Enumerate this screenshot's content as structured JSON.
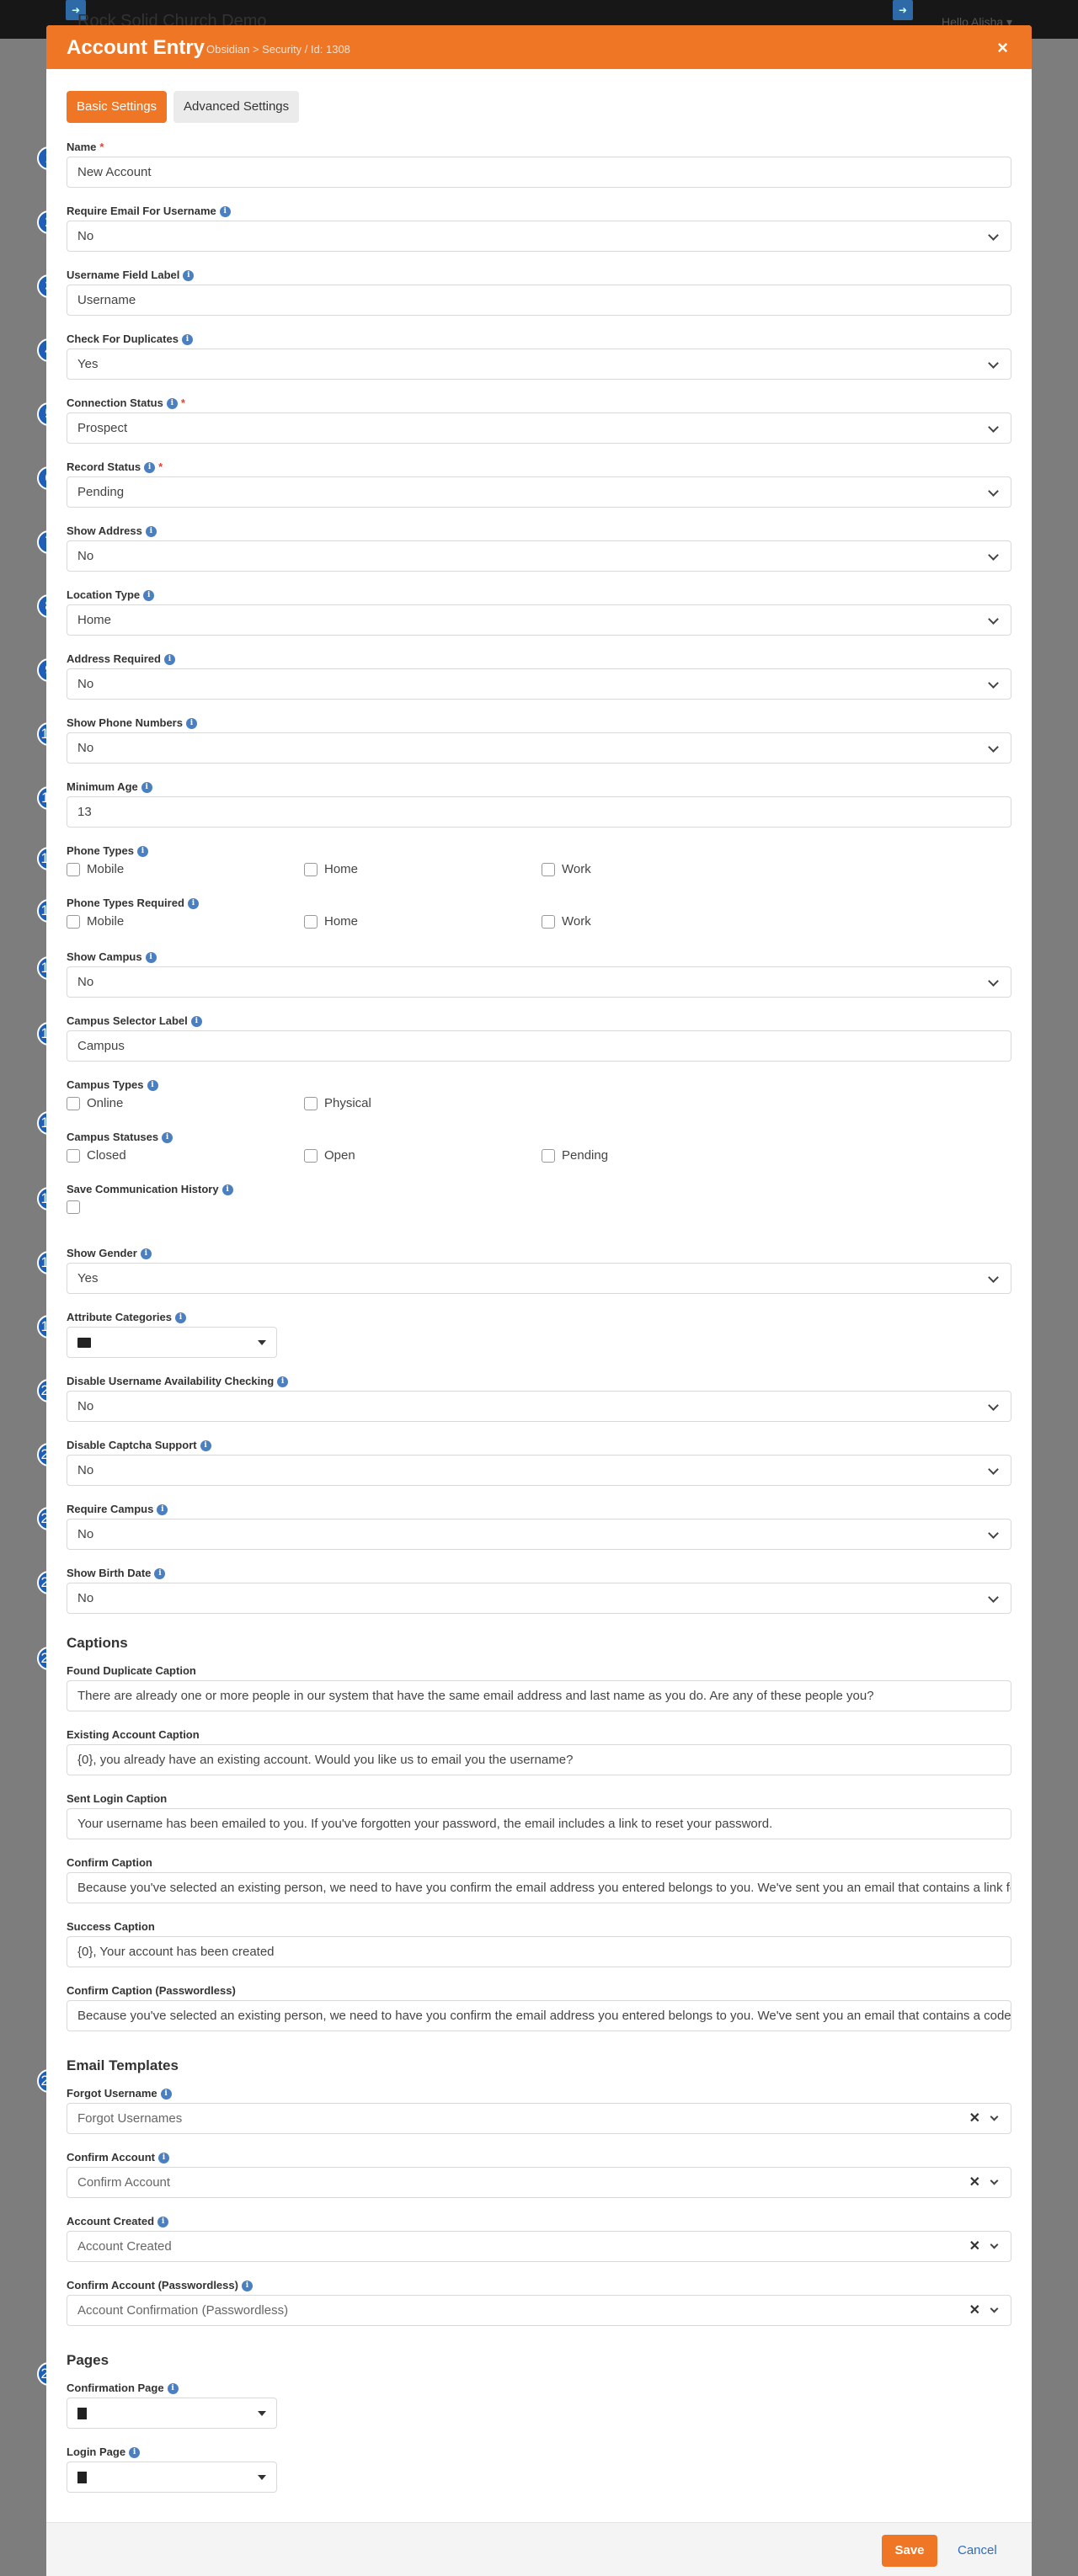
{
  "background": {
    "title": "Rock Solid Church Demo",
    "hello": "Hello Alisha ▾"
  },
  "header": {
    "title": "Account Entry",
    "subtitle": "Obsidian > Security / Id: 1308",
    "close": "×"
  },
  "tabs": [
    {
      "label": "Basic Settings"
    },
    {
      "label": "Advanced Settings"
    }
  ],
  "badges": [
    "1",
    "2",
    "3",
    "4",
    "5",
    "6",
    "7",
    "8",
    "9",
    "10",
    "11",
    "12",
    "13",
    "14",
    "15",
    "16",
    "17",
    "18",
    "19",
    "20",
    "21",
    "22",
    "23",
    "24",
    "25",
    "26"
  ],
  "fields": {
    "name": {
      "label": "Name",
      "value": "New Account"
    },
    "require_email": {
      "label": "Require Email For Username",
      "value": "No"
    },
    "username_label": {
      "label": "Username Field Label",
      "value": "Username"
    },
    "check_duplicates": {
      "label": "Check For Duplicates",
      "value": "Yes"
    },
    "connection_status": {
      "label": "Connection Status",
      "value": "Prospect"
    },
    "record_status": {
      "label": "Record Status",
      "value": "Pending"
    },
    "show_address": {
      "label": "Show Address",
      "value": "No"
    },
    "location_type": {
      "label": "Location Type",
      "value": "Home"
    },
    "address_required": {
      "label": "Address Required",
      "value": "No"
    },
    "show_phone": {
      "label": "Show Phone Numbers",
      "value": "No"
    },
    "minimum_age": {
      "label": "Minimum Age",
      "value": "13"
    },
    "phone_types": {
      "label": "Phone Types",
      "options": [
        "Mobile",
        "Home",
        "Work"
      ]
    },
    "phone_types_required": {
      "label": "Phone Types Required",
      "options": [
        "Mobile",
        "Home",
        "Work"
      ]
    },
    "show_campus": {
      "label": "Show Campus",
      "value": "No"
    },
    "campus_selector_label": {
      "label": "Campus Selector Label",
      "value": "Campus"
    },
    "campus_types": {
      "label": "Campus Types",
      "options": [
        "Online",
        "Physical"
      ]
    },
    "campus_statuses": {
      "label": "Campus Statuses",
      "options": [
        "Closed",
        "Open",
        "Pending"
      ]
    },
    "save_comm_history": {
      "label": "Save Communication History"
    },
    "show_gender": {
      "label": "Show Gender",
      "value": "Yes"
    },
    "attribute_categories": {
      "label": "Attribute Categories"
    },
    "disable_username_check": {
      "label": "Disable Username Availability Checking",
      "value": "No"
    },
    "disable_captcha": {
      "label": "Disable Captcha Support",
      "value": "No"
    },
    "require_campus": {
      "label": "Require Campus",
      "value": "No"
    },
    "show_birth_date": {
      "label": "Show Birth Date",
      "value": "No"
    }
  },
  "captions": {
    "title": "Captions",
    "found_duplicate": {
      "label": "Found Duplicate Caption",
      "value": "There are already one or more people in our system that have the same email address and last name as you do.  Are any of these people you?"
    },
    "existing_account": {
      "label": "Existing Account Caption",
      "value": "{0}, you already have an existing account.  Would you like us to email you the username?"
    },
    "sent_login": {
      "label": "Sent Login Caption",
      "value": "Your username has been emailed to you.  If you've forgotten your password, the email includes a link to reset your password."
    },
    "confirm": {
      "label": "Confirm Caption",
      "value": "Because you've selected an existing person, we need to have you confirm the email address you entered belongs to you. We've sent you an email that contains a link for confirming."
    },
    "success": {
      "label": "Success Caption",
      "value": "{0}, Your account has been created"
    },
    "confirm_passwordless": {
      "label": "Confirm Caption (Passwordless)",
      "value": "Because you've selected an existing person, we need to have you confirm the email address you entered belongs to you. We've sent you an email that contains a code for confirming."
    }
  },
  "email_templates": {
    "title": "Email Templates",
    "forgot_username": {
      "label": "Forgot Username",
      "value": "Forgot Usernames"
    },
    "confirm_account": {
      "label": "Confirm Account",
      "value": "Confirm Account"
    },
    "account_created": {
      "label": "Account Created",
      "value": "Account Created"
    },
    "confirm_passwordless": {
      "label": "Confirm Account (Passwordless)",
      "value": "Account Confirmation (Passwordless)"
    }
  },
  "pages": {
    "title": "Pages",
    "confirmation_page": {
      "label": "Confirmation Page"
    },
    "login_page": {
      "label": "Login Page"
    }
  },
  "footer": {
    "save": "Save",
    "cancel": "Cancel"
  },
  "icons": {
    "info": "info-circle-icon",
    "close": "close-icon",
    "chevron": "chevron-down-icon"
  },
  "colors": {
    "accent": "#ee7625",
    "badge": "#1f5fb8",
    "link": "#2f6db8",
    "info": "#4a7fc1"
  }
}
